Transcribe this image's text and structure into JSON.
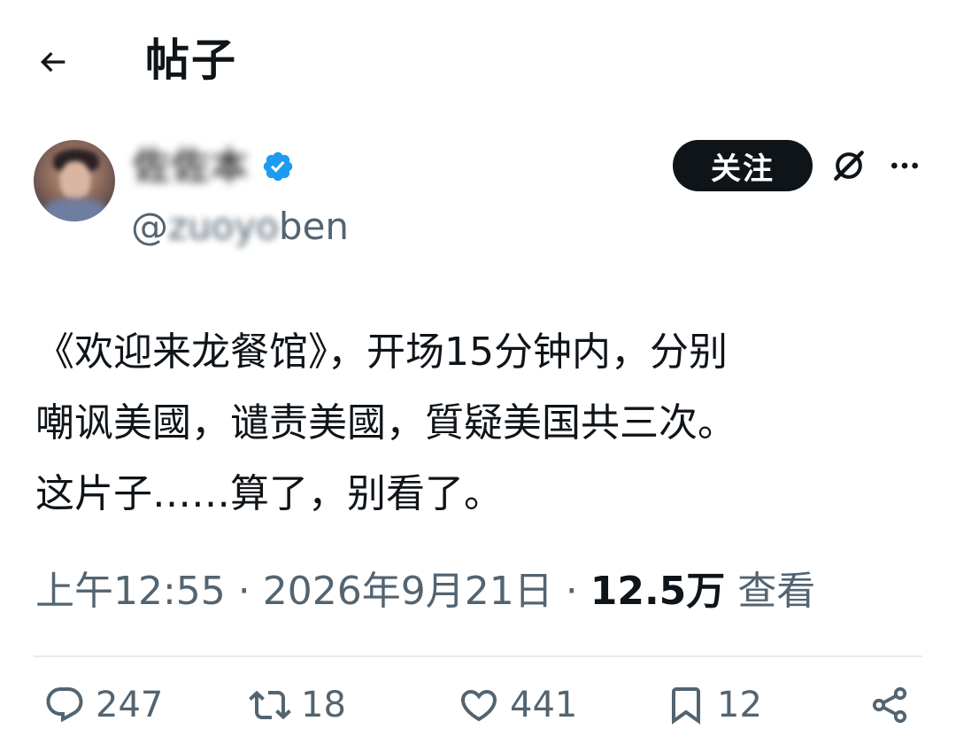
{
  "header": {
    "title": "帖子",
    "back_icon": "arrow-left-icon"
  },
  "author": {
    "display_name": "佐佐本",
    "handle_prefix": "@",
    "handle_hidden": "zuoyo",
    "handle_suffix": "ben",
    "verified_icon": "verified-badge-icon",
    "verified_color": "#1d9bf0"
  },
  "actions_top": {
    "follow_label": "关注",
    "grok_icon": "grok-icon",
    "more_icon": "more-dots-icon"
  },
  "post": {
    "text": "《欢迎来龙餐馆》，开场15分钟内，分别\n嘲讽美國，谴责美國，質疑美国共三次。\n这片子……算了，别看了。"
  },
  "meta": {
    "time": "上午12:55",
    "date": "2026年9月21日",
    "separator": " · ",
    "views_count": "12.5万",
    "views_label": "查看"
  },
  "engagement": {
    "replies": "247",
    "reposts": "18",
    "likes": "441",
    "bookmarks": "12",
    "reply_icon": "reply-icon",
    "repost_icon": "repost-icon",
    "like_icon": "heart-icon",
    "bookmark_icon": "bookmark-icon",
    "share_icon": "share-icon"
  },
  "colors": {
    "text_primary": "#0f1419",
    "text_secondary": "#536471",
    "follow_bg": "#0f1419",
    "divider": "#e6ecf0"
  }
}
